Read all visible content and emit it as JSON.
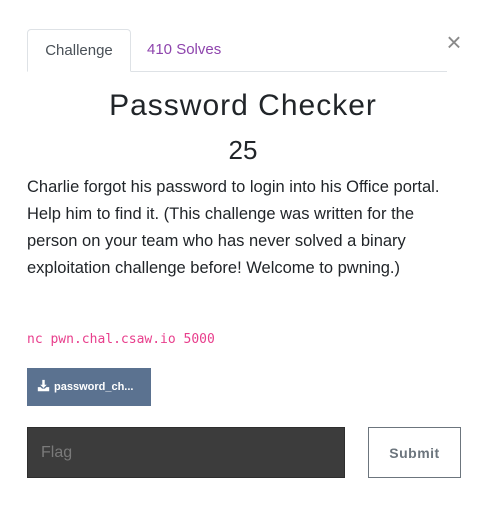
{
  "tabs": {
    "challenge_label": "Challenge",
    "solves_label": "410 Solves"
  },
  "close": {
    "glyph": "×",
    "icon": "close-icon"
  },
  "challenge": {
    "name": "Password Checker",
    "value": "25",
    "description": "Charlie forgot his password to login into his Office portal. Help him to find it. (This challenge was written for the person on your team who has never solved a binary exploitation challenge before! Welcome to pwning.)",
    "connection_info": "nc pwn.chal.csaw.io 5000",
    "file": {
      "label": "password_ch...",
      "icon": "download-icon"
    }
  },
  "form": {
    "flag_placeholder": "Flag",
    "flag_value": "",
    "submit_label": "Submit"
  },
  "colors": {
    "solves_link": "#8e44ad",
    "connection_text": "#e83e8c",
    "file_button_bg": "#5b7290",
    "flag_input_bg": "#3c3c3c",
    "submit_border": "#6c757d"
  }
}
